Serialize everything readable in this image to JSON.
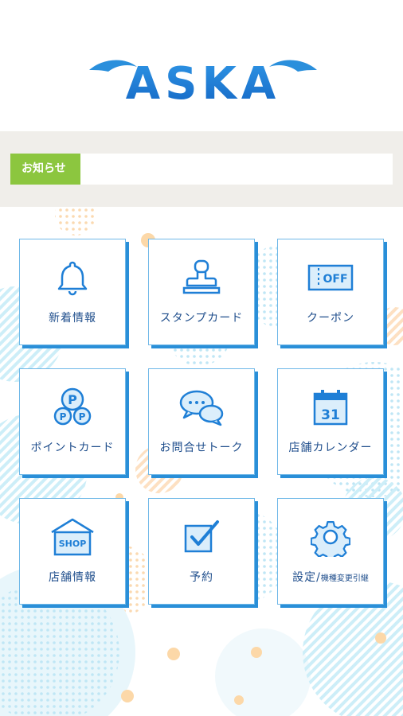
{
  "app": {
    "logo_text": "ASKA"
  },
  "notice": {
    "label": "お知らせ",
    "text": ""
  },
  "menu": [
    {
      "label": "新着情報",
      "icon": "bell-icon"
    },
    {
      "label": "スタンプカード",
      "icon": "stamp-icon"
    },
    {
      "label": "クーポン",
      "icon": "coupon-icon",
      "icon_text": "OFF"
    },
    {
      "label": "ポイントカード",
      "icon": "point-card-icon",
      "icon_text": "P"
    },
    {
      "label": "お問合せトーク",
      "icon": "chat-icon"
    },
    {
      "label": "店舗カレンダー",
      "icon": "calendar-icon",
      "icon_text": "31"
    },
    {
      "label": "店舗情報",
      "icon": "shop-icon",
      "icon_text": "SHOP"
    },
    {
      "label": "予約",
      "icon": "checkbox-icon"
    },
    {
      "label": "設定/",
      "sublabel": "機種変更引継",
      "icon": "gear-icon"
    }
  ],
  "colors": {
    "primary": "#1f7fd6",
    "notice_green": "#8cc63f",
    "tile_border": "#6fb8e8"
  }
}
